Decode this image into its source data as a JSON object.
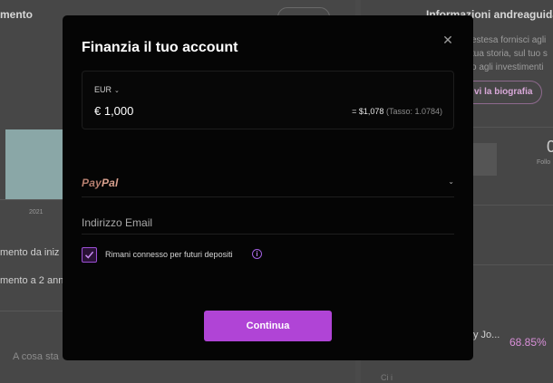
{
  "background": {
    "left_title": "mento",
    "chart_year": "2021",
    "left_text1": "mento da iniz",
    "left_text2": "mento a 2 ann",
    "left_text3": "A cosa sta",
    "right_title": "Informazioni andreaguida",
    "bio_lines": [
      "estesa fornisci agli",
      "tua storia, sul tuo s",
      "o agli investimenti"
    ],
    "bio_button": "vi la biografia",
    "right_stat_num": "0",
    "right_stat_label": "Follo",
    "right_row": "y Jo...",
    "right_pct": "68.85%",
    "right_foot": "Ci i"
  },
  "modal": {
    "title": "Finanzia il tuo account",
    "close_icon": "close-icon",
    "currency": "EUR",
    "amount": "€ 1,000",
    "conversion_usd": "= $1,078",
    "conversion_rate": "(Tasso: 1.0784)",
    "payment_method": {
      "pay": "Pay",
      "pal": "Pal"
    },
    "email_placeholder": "Indirizzo Email",
    "email_value": "",
    "remember_label": "Rimani connesso per futuri depositi",
    "remember_checked": true,
    "info_icon_glyph": "i",
    "continue_label": "Continua",
    "colors": {
      "accent": "#b044d6",
      "checkbox_border": "#9c4fd6",
      "paypal": "#d8a08e"
    }
  }
}
